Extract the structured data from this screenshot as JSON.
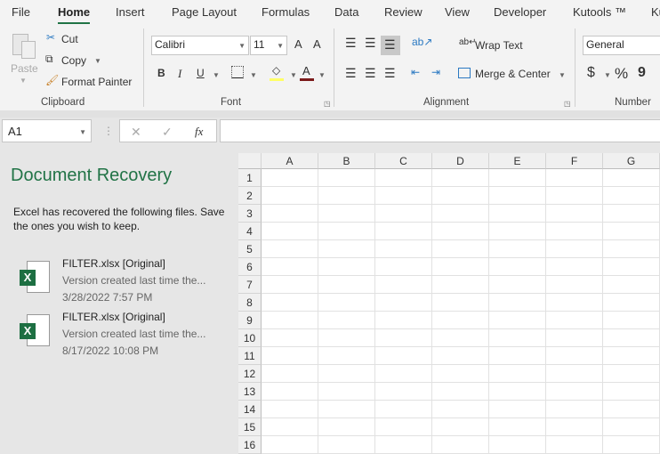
{
  "menu": {
    "tabs": [
      "File",
      "Home",
      "Insert",
      "Page Layout",
      "Formulas",
      "Data",
      "Review",
      "View",
      "Developer",
      "Kutools ™",
      "Ku"
    ],
    "active": "Home"
  },
  "clipboard": {
    "paste": "Paste",
    "cut": "Cut",
    "copy": "Copy",
    "format_painter": "Format Painter",
    "label": "Clipboard"
  },
  "font": {
    "name": "Calibri",
    "size": "11",
    "bold": "B",
    "italic": "I",
    "underline": "U",
    "grow": "A",
    "shrink": "A",
    "font_color": "A",
    "label": "Font",
    "fill_color": "#ffff00",
    "text_color": "#c00000"
  },
  "alignment": {
    "wrap_text": "Wrap Text",
    "merge_center": "Merge & Center",
    "label": "Alignment"
  },
  "number": {
    "format": "General",
    "currency": "$",
    "percent": "%",
    "comma": "9",
    "label": "Number"
  },
  "formula_bar": {
    "name_box": "A1",
    "cancel": "✕",
    "enter": "✓",
    "fx": "fx",
    "value": ""
  },
  "recovery": {
    "title": "Document Recovery",
    "description": "Excel has recovered the following files.  Save the ones you wish to keep.",
    "files": [
      {
        "name": "FILTER.xlsx  [Original]",
        "desc": "Version created last time the...",
        "time": "3/28/2022 7:57 PM"
      },
      {
        "name": "FILTER.xlsx  [Original]",
        "desc": "Version created last time the...",
        "time": "8/17/2022 10:08 PM"
      }
    ]
  },
  "sheet": {
    "columns": [
      "A",
      "B",
      "C",
      "D",
      "E",
      "F",
      "G"
    ],
    "rows": [
      "1",
      "2",
      "3",
      "4",
      "5",
      "6",
      "7",
      "8",
      "9",
      "10",
      "11",
      "12",
      "13",
      "14",
      "15",
      "16"
    ]
  },
  "colors": {
    "accent": "#217346"
  }
}
